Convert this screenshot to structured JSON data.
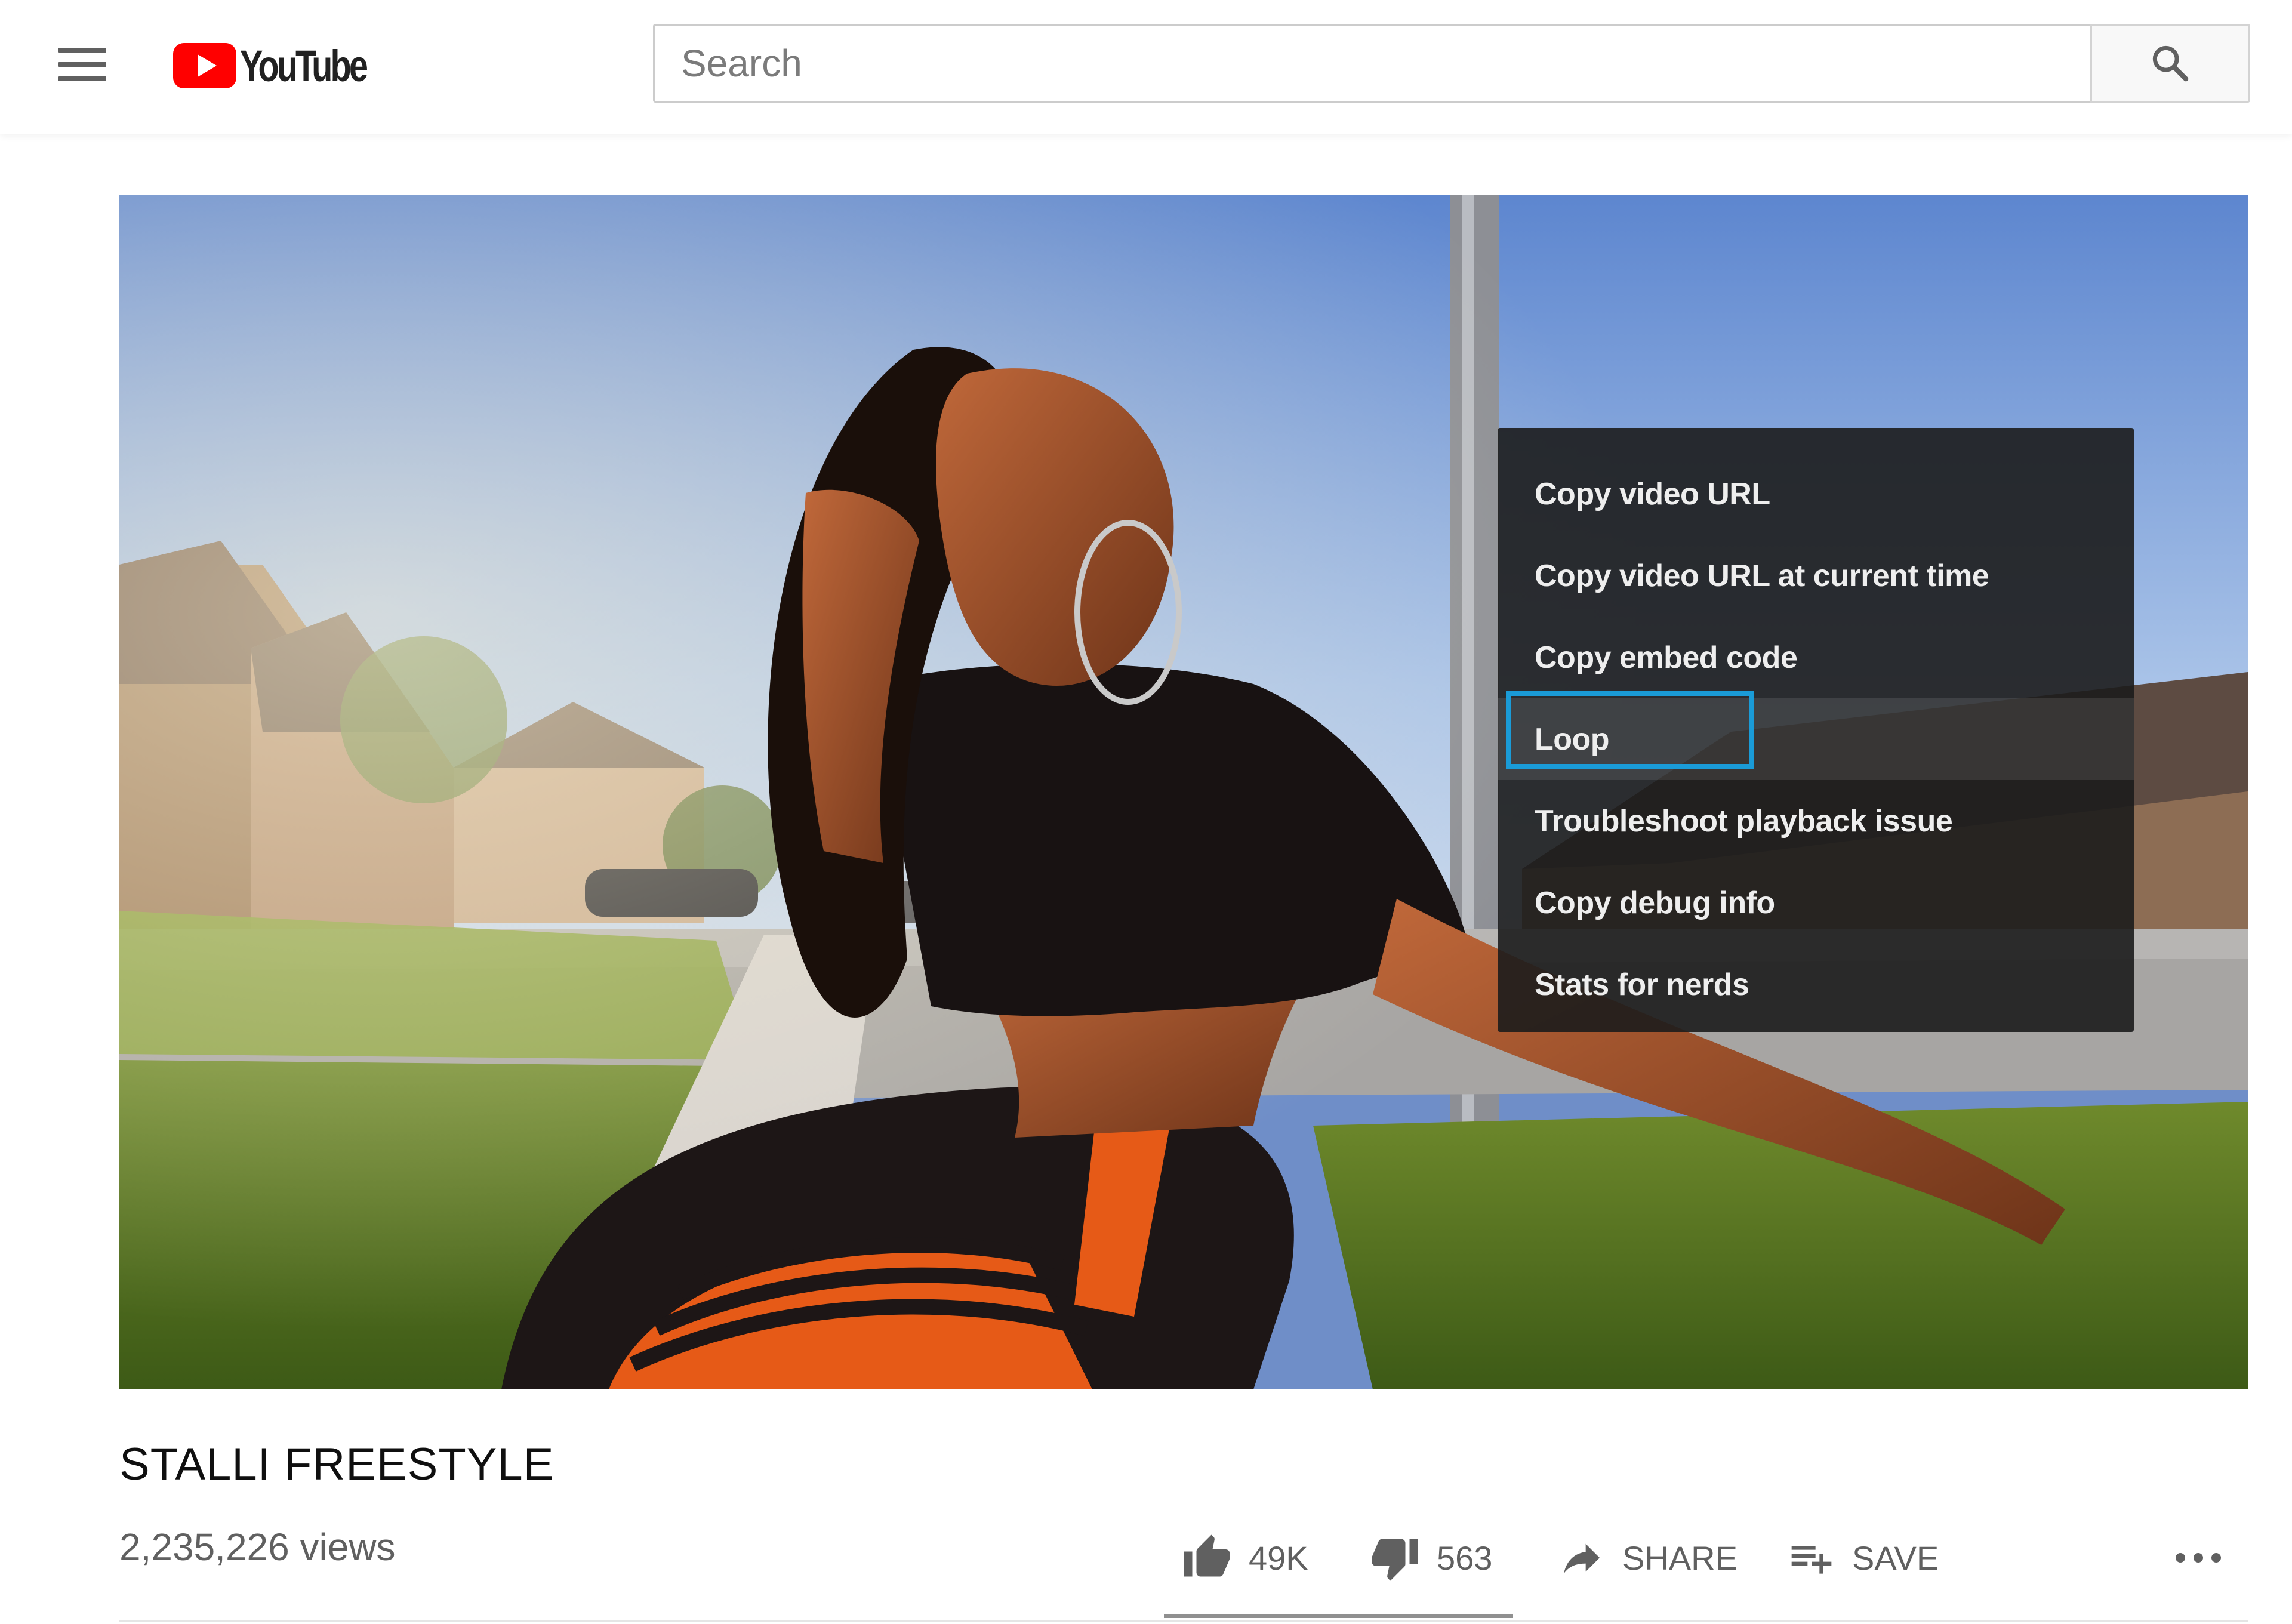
{
  "header": {
    "menu_icon": "hamburger-menu-icon",
    "logo_text": "YouTube",
    "search_placeholder": "Search",
    "search_icon": "search-icon"
  },
  "player": {
    "context_menu": {
      "items": [
        {
          "label": "Copy video URL"
        },
        {
          "label": "Copy video URL at current time"
        },
        {
          "label": "Copy embed code"
        },
        {
          "label": "Loop",
          "highlighted": true
        },
        {
          "label": "Troubleshoot playback issue"
        },
        {
          "label": "Copy debug info"
        },
        {
          "label": "Stats for nerds"
        }
      ]
    }
  },
  "video": {
    "title": "STALLI FREESTYLE",
    "views": "2,235,226 views"
  },
  "actions": {
    "like_count": "49K",
    "dislike_count": "563",
    "share_label": "SHARE",
    "save_label": "SAVE",
    "more_icon": "more-horizontal-icon"
  },
  "colors": {
    "brand_red": "#ff0000",
    "focus_outline": "#1a9bd7",
    "menu_background": "#1c1c1c"
  }
}
